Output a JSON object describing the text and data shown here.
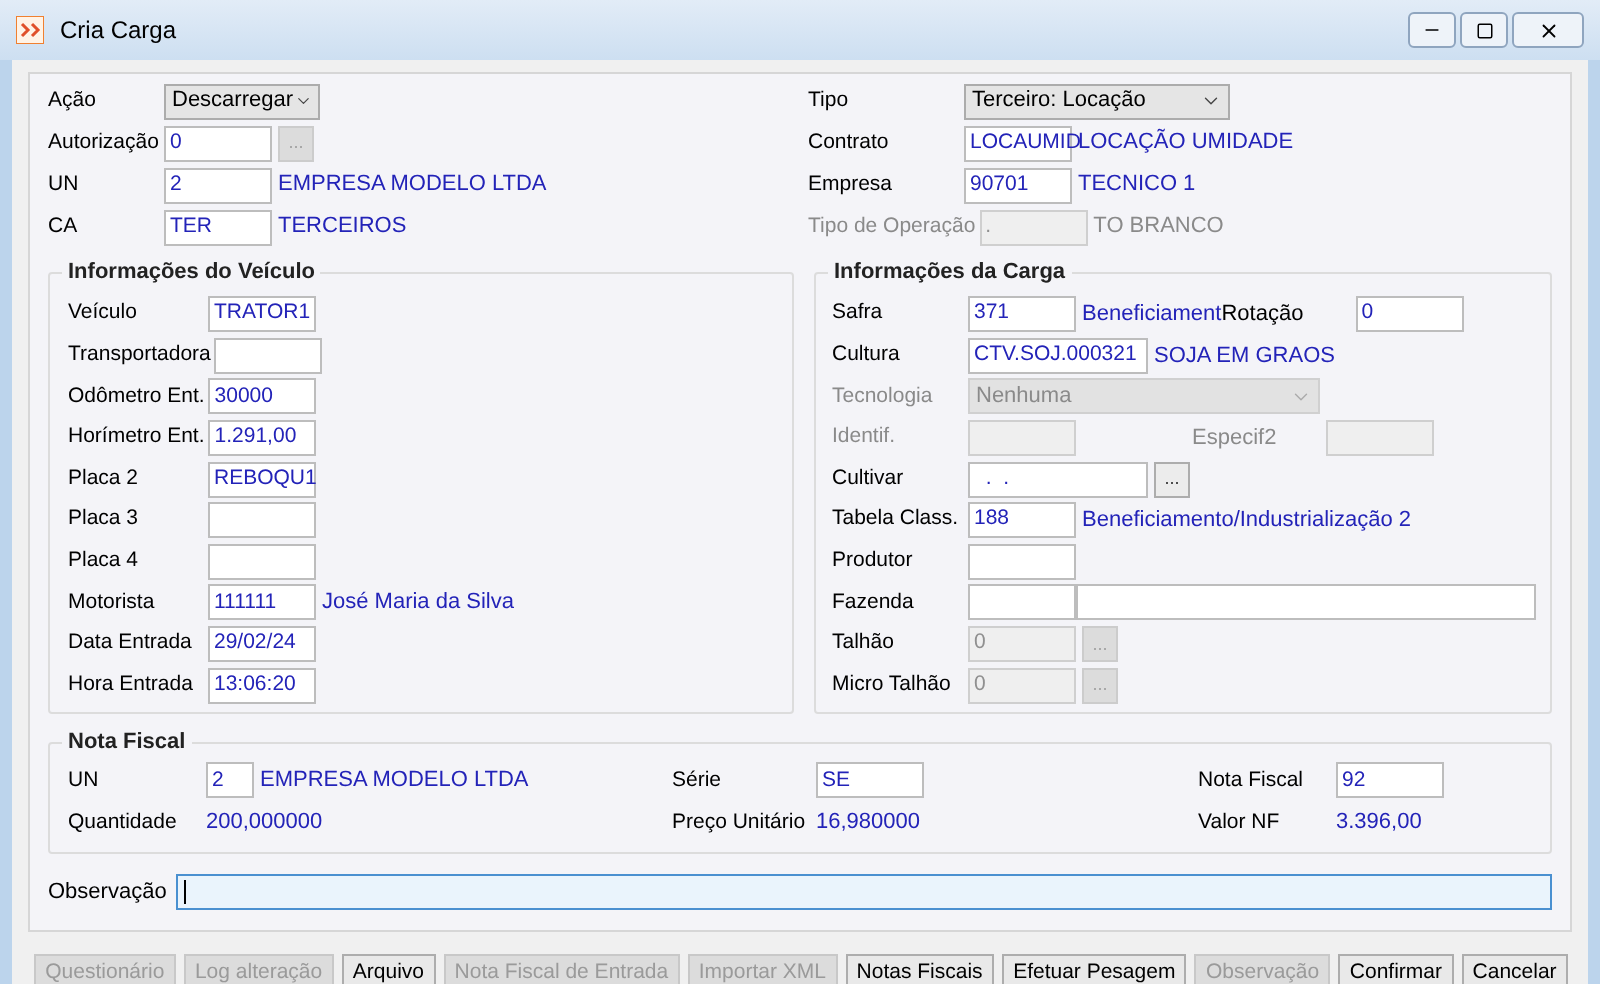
{
  "window": {
    "title": "Cria Carga"
  },
  "header": {
    "left": [
      {
        "label": "Ação",
        "disabled": false,
        "controls": [
          {
            "kind": "select",
            "value": "Descarregar",
            "disabled": false
          }
        ]
      },
      {
        "label": "Autorização",
        "disabled": false,
        "controls": [
          {
            "kind": "input",
            "value": "0",
            "disabled": false
          },
          {
            "kind": "ellipsis",
            "value": "...",
            "disabled": true
          }
        ]
      },
      {
        "label": "UN",
        "disabled": false,
        "controls": [
          {
            "kind": "input",
            "value": "2",
            "disabled": false
          },
          {
            "kind": "text",
            "value": "EMPRESA MODELO LTDA",
            "disabled": false
          }
        ]
      },
      {
        "label": "CA",
        "disabled": false,
        "controls": [
          {
            "kind": "input",
            "value": "TER",
            "disabled": false
          },
          {
            "kind": "text",
            "value": "TERCEIROS",
            "disabled": false
          }
        ]
      }
    ],
    "right": [
      {
        "label": "Tipo",
        "disabled": false,
        "controls": [
          {
            "kind": "wide_select",
            "value": "Terceiro: Locação",
            "disabled": false
          }
        ]
      },
      {
        "label": "Contrato",
        "disabled": false,
        "controls": [
          {
            "kind": "input",
            "value": "LOCAUMID",
            "disabled": false
          },
          {
            "kind": "text",
            "value": "LOCAÇÃO UMIDADE",
            "disabled": false
          }
        ]
      },
      {
        "label": "Empresa",
        "disabled": false,
        "controls": [
          {
            "kind": "input",
            "value": "90701",
            "disabled": false
          },
          {
            "kind": "text",
            "value": "TECNICO 1",
            "disabled": false
          }
        ]
      },
      {
        "label": "Tipo de Operação",
        "disabled": true,
        "controls": [
          {
            "kind": "input",
            "value": ".",
            "disabled": true
          },
          {
            "kind": "text",
            "value": "TO BRANCO",
            "disabled": true
          }
        ]
      }
    ]
  },
  "vehicle": {
    "title": "Informações do Veículo",
    "rows": [
      {
        "label": "Veículo",
        "disabled": false,
        "controls": [
          {
            "kind": "input",
            "value": "TRATOR1",
            "disabled": false
          }
        ]
      },
      {
        "label": "Transportadora",
        "disabled": false,
        "controls": [
          {
            "kind": "input",
            "disabled": false
          }
        ]
      },
      {
        "label": "Odômetro Ent.",
        "disabled": false,
        "controls": [
          {
            "kind": "input",
            "value": "30000",
            "disabled": false
          }
        ]
      },
      {
        "label": "Horímetro Ent.",
        "disabled": false,
        "controls": [
          {
            "kind": "input",
            "value": "1.291,00",
            "disabled": false
          }
        ]
      },
      {
        "label": "Placa 2",
        "disabled": false,
        "controls": [
          {
            "kind": "input",
            "value": "REBOQU1",
            "disabled": false
          }
        ]
      },
      {
        "label": "Placa 3",
        "disabled": false,
        "controls": [
          {
            "kind": "input",
            "disabled": false
          }
        ]
      },
      {
        "label": "Placa 4",
        "disabled": false,
        "controls": [
          {
            "kind": "input",
            "disabled": false
          }
        ]
      },
      {
        "label": "Motorista",
        "disabled": false,
        "controls": [
          {
            "kind": "input",
            "value": "111111",
            "disabled": false
          },
          {
            "kind": "text",
            "value": "José Maria da Silva",
            "disabled": false
          }
        ]
      },
      {
        "label": "Data Entrada",
        "disabled": false,
        "controls": [
          {
            "kind": "input",
            "value": "29/02/24",
            "disabled": false
          }
        ]
      },
      {
        "label": "Hora Entrada",
        "disabled": false,
        "controls": [
          {
            "kind": "input",
            "value": "13:06:20",
            "disabled": false
          }
        ]
      }
    ]
  },
  "cargo": {
    "title": "Informações da Carga",
    "rows": [
      {
        "label": "Safra",
        "disabled": false,
        "controls": [
          {
            "kind": "input",
            "value": "371",
            "disabled": false
          },
          {
            "kind": "text",
            "value": "Beneficiament",
            "disabled": false
          },
          {
            "kind": "label",
            "value": "Rotação",
            "disabled": false
          },
          {
            "kind": "input",
            "value": "0",
            "disabled": false
          }
        ]
      },
      {
        "label": "Cultura",
        "disabled": false,
        "controls": [
          {
            "kind": "wide_input",
            "value": "CTV.SOJ.000321",
            "disabled": false
          },
          {
            "kind": "text",
            "value": "SOJA EM GRAOS",
            "disabled": false
          }
        ]
      },
      {
        "label": "Tecnologia",
        "disabled": true,
        "controls": [
          {
            "kind": "long_select",
            "value": "Nenhuma",
            "disabled": true
          }
        ]
      },
      {
        "label": "Identif.",
        "disabled": true,
        "controls": [
          {
            "kind": "input",
            "disabled": true
          },
          {
            "kind": "label",
            "value": "Especif2",
            "disabled": true
          },
          {
            "kind": "input",
            "disabled": true
          }
        ]
      },
      {
        "label": "Cultivar",
        "disabled": false,
        "controls": [
          {
            "kind": "wide_input",
            "value": "  .  .",
            "disabled": false
          },
          {
            "kind": "ellipsis",
            "value": "...",
            "disabled": false
          }
        ]
      },
      {
        "label": "Tabela Class.",
        "disabled": false,
        "controls": [
          {
            "kind": "input",
            "value": "188",
            "disabled": false
          },
          {
            "kind": "text",
            "value": "Beneficiamento/Industrialização 2",
            "disabled": false
          }
        ]
      },
      {
        "label": "Produtor",
        "disabled": false,
        "controls": [
          {
            "kind": "input",
            "disabled": false
          }
        ]
      },
      {
        "label": "Fazenda",
        "disabled": false,
        "controls": [
          {
            "kind": "input",
            "disabled": false
          },
          {
            "kind": "long_input",
            "disabled": false
          }
        ]
      },
      {
        "label": "Talhão",
        "disabled": false,
        "controls": [
          {
            "kind": "input",
            "value": "0",
            "disabled": true
          },
          {
            "kind": "ellipsis",
            "value": "...",
            "disabled": true
          }
        ]
      },
      {
        "label": "Micro Talhão",
        "disabled": false,
        "controls": [
          {
            "kind": "input",
            "value": "0",
            "disabled": true
          },
          {
            "kind": "ellipsis",
            "value": "...",
            "disabled": true
          }
        ]
      }
    ]
  },
  "nota_fiscal": {
    "title": "Nota Fiscal",
    "columns": [
      [
        {
          "label": "UN",
          "disabled": false,
          "controls": [
            {
              "kind": "short_input",
              "value": "2",
              "disabled": false
            },
            {
              "kind": "text",
              "value": "EMPRESA MODELO LTDA",
              "disabled": false
            }
          ]
        },
        {
          "label": "Quantidade",
          "disabled": false,
          "controls": [
            {
              "kind": "value",
              "value": "200,000000",
              "disabled": false
            }
          ]
        }
      ],
      [
        {
          "label": "Série",
          "disabled": false,
          "controls": [
            {
              "kind": "input",
              "value": "SE",
              "disabled": false
            }
          ]
        },
        {
          "label": "Preço Unitário",
          "disabled": false,
          "controls": [
            {
              "kind": "value",
              "value": "16,980000",
              "disabled": false
            }
          ]
        }
      ],
      [
        {
          "label": "Nota Fiscal",
          "disabled": false,
          "controls": [
            {
              "kind": "input",
              "value": "92",
              "disabled": false
            }
          ]
        },
        {
          "label": "Valor NF",
          "disabled": false,
          "controls": [
            {
              "kind": "value",
              "value": "3.396,00",
              "disabled": false
            }
          ]
        }
      ]
    ]
  },
  "observacao": {
    "label": "Observação",
    "focused": true
  },
  "buttons": [
    {
      "label": "Questionário",
      "disabled": true
    },
    {
      "label": "Log alteração",
      "disabled": true
    },
    {
      "label": "Arquivo",
      "disabled": false
    },
    {
      "label": "Nota Fiscal de Entrada",
      "disabled": true
    },
    {
      "label": "Importar XML",
      "disabled": true
    },
    {
      "label": "Notas Fiscais",
      "disabled": false
    },
    {
      "label": "Efetuar Pesagem",
      "disabled": false
    },
    {
      "label": "Observação",
      "disabled": true
    },
    {
      "label": "Confirmar",
      "disabled": false
    },
    {
      "label": "Cancelar",
      "disabled": false
    }
  ]
}
